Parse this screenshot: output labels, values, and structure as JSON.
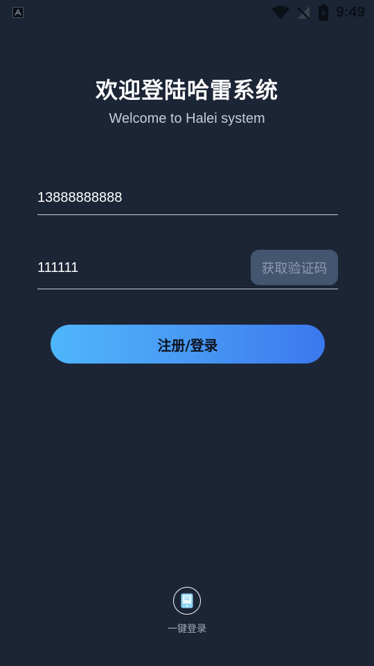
{
  "status_bar": {
    "time": "9:49",
    "icons": [
      "android-notification-icon",
      "wifi-icon",
      "no-signal-icon",
      "battery-charging-icon"
    ]
  },
  "header": {
    "title": "欢迎登陆哈雷系统",
    "subtitle": "Welcome to Halei system"
  },
  "form": {
    "phone_value": "13888888888",
    "code_value": "111111",
    "get_code_label": "获取验证码",
    "submit_label": "注册/登录"
  },
  "quick_login": {
    "icon": "phone-icon",
    "label": "一键登录"
  },
  "colors": {
    "background": "#1c2536",
    "button_gradient_start": "#4fb6fb",
    "button_gradient_end": "#3a78ee",
    "get_code_bg": "#44556f"
  }
}
